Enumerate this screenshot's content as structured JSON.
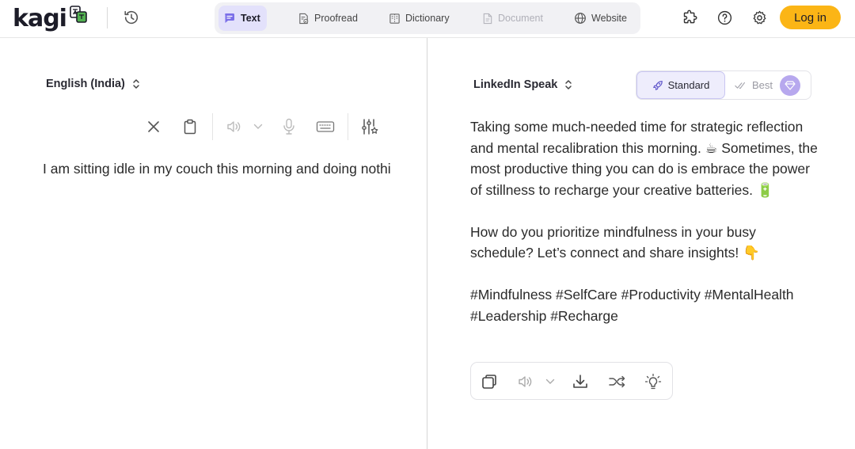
{
  "header": {
    "logo_text": "kagi",
    "tabs": [
      {
        "label": "Text",
        "icon": "chat-bubble-icon",
        "state": "active"
      },
      {
        "label": "Proofread",
        "icon": "document-check-icon",
        "state": "normal"
      },
      {
        "label": "Dictionary",
        "icon": "book-icon",
        "state": "normal"
      },
      {
        "label": "Document",
        "icon": "file-icon",
        "state": "disabled"
      },
      {
        "label": "Website",
        "icon": "globe-icon",
        "state": "normal"
      }
    ],
    "right_icons": [
      "extension-icon",
      "help-icon",
      "gear-icon"
    ],
    "login_label": "Log in"
  },
  "source": {
    "language": "English (India)",
    "text": "I am sitting idle in my couch this morning and doing nothi",
    "toolbar_icons": [
      "close-icon",
      "clipboard-icon",
      "speaker-icon",
      "chevron-down-icon",
      "microphone-icon",
      "keyboard-icon",
      "settings-sliders-icon"
    ]
  },
  "target": {
    "style": "LinkedIn Speak",
    "quality": {
      "standard_label": "Standard",
      "best_label": "Best",
      "selected": "Standard"
    },
    "paragraphs": [
      "Taking some much-needed time for strategic reflection and mental recalibration this morning. ☕ Sometimes, the most productive thing you can do is embrace the power of stillness to recharge your creative batteries. 🔋",
      "How do you prioritize mindfulness in your busy schedule? Let’s connect and share insights! 👇",
      "#Mindfulness #SelfCare #Productivity #MentalHealth #Leadership #Recharge"
    ],
    "toolbar_icons": [
      "copy-icon",
      "speaker-icon",
      "chevron-down-icon",
      "download-icon",
      "shuffle-icon",
      "lightbulb-icon"
    ]
  },
  "colors": {
    "accent_purple": "#e3e1fb",
    "login_yellow": "#fbb516",
    "gem_purple": "#b7a8ee"
  }
}
